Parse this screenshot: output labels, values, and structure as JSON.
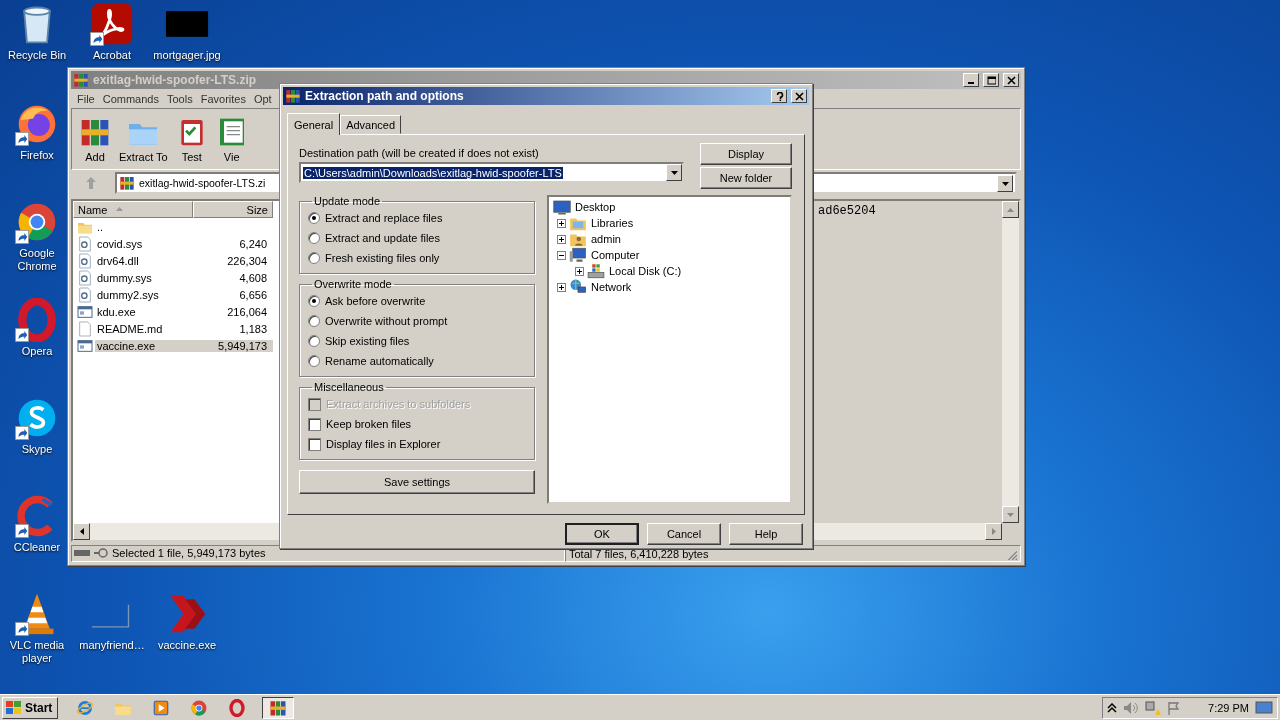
{
  "desktop_icons": [
    {
      "label": "Recycle Bin",
      "kind": "recycle",
      "shortcut": false
    },
    {
      "label": "Acrobat",
      "kind": "acrobat",
      "shortcut": true
    },
    {
      "label": "mortgager.jpg",
      "kind": "image",
      "shortcut": false
    },
    {
      "label": "Firefox",
      "kind": "firefox",
      "shortcut": true
    },
    {
      "label": "Google Chrome",
      "kind": "chrome",
      "shortcut": true
    },
    {
      "label": "Opera",
      "kind": "opera",
      "shortcut": true
    },
    {
      "label": "Skype",
      "kind": "skype",
      "shortcut": true
    },
    {
      "label": "CCleaner",
      "kind": "ccleaner",
      "shortcut": true
    },
    {
      "label": "VLC media player",
      "kind": "vlc",
      "shortcut": true
    },
    {
      "label": "manyfriend…",
      "kind": "blank",
      "shortcut": false
    },
    {
      "label": "vaccine.exe",
      "kind": "vaccine",
      "shortcut": false
    }
  ],
  "archive_window": {
    "title": "exitlag-hwid-spoofer-LTS.zip",
    "menu": [
      "File",
      "Commands",
      "Tools",
      "Favorites",
      "Opt"
    ],
    "toolbar": [
      {
        "label": "Add",
        "kind": "add"
      },
      {
        "label": "Extract To",
        "kind": "extract"
      },
      {
        "label": "Test",
        "kind": "test"
      },
      {
        "label": "Vie",
        "kind": "view"
      }
    ],
    "address": "exitlag-hwid-spoofer-LTS.zi",
    "columns": [
      "Name",
      "Size"
    ],
    "files": [
      {
        "name": "..",
        "kind": "folder",
        "selected": false
      },
      {
        "name": "covid.sys",
        "size": "6,240",
        "kind": "sys",
        "selected": false
      },
      {
        "name": "drv64.dll",
        "size": "226,304",
        "kind": "sys",
        "selected": false
      },
      {
        "name": "dummy.sys",
        "size": "4,608",
        "kind": "sys",
        "selected": false
      },
      {
        "name": "dummy2.sys",
        "size": "6,656",
        "kind": "sys",
        "selected": false
      },
      {
        "name": "kdu.exe",
        "size": "216,064",
        "kind": "exe",
        "selected": false
      },
      {
        "name": "README.md",
        "size": "1,183",
        "kind": "text",
        "selected": false
      },
      {
        "name": "vaccine.exe",
        "size": "5,949,173",
        "kind": "exe",
        "selected": true
      }
    ],
    "comment": "ad6e5204",
    "status": [
      "Selected 1 file, 5,949,173 bytes",
      "Total 7 files, 6,410,228 bytes"
    ]
  },
  "dialog": {
    "title": "Extraction path and options",
    "tabs": [
      {
        "label": "General",
        "selected": true
      },
      {
        "label": "Advanced",
        "selected": false
      }
    ],
    "destination_label": "Destination path (will be created if does not exist)",
    "destination_path": "C:\\Users\\admin\\Downloads\\exitlag-hwid-spoofer-LTS",
    "side_buttons": [
      "Display",
      "New folder"
    ],
    "groups": [
      {
        "title": "Update mode",
        "kind": "radio",
        "options": [
          {
            "label": "Extract and replace files",
            "selected": true
          },
          {
            "label": "Extract and update files",
            "selected": false
          },
          {
            "label": "Fresh existing files only",
            "selected": false
          }
        ]
      },
      {
        "title": "Overwrite mode",
        "kind": "radio",
        "options": [
          {
            "label": "Ask before overwrite",
            "selected": true
          },
          {
            "label": "Overwrite without prompt",
            "selected": false
          },
          {
            "label": "Skip existing files",
            "selected": false
          },
          {
            "label": "Rename automatically",
            "selected": false
          }
        ]
      },
      {
        "title": "Miscellaneous",
        "kind": "checkbox",
        "options": [
          {
            "label": "Extract archives to subfolders",
            "checked": false,
            "disabled": true
          },
          {
            "label": "Keep broken files",
            "checked": false,
            "disabled": false
          },
          {
            "label": "Display files in Explorer",
            "checked": false,
            "disabled": false
          }
        ]
      }
    ],
    "save_button": "Save settings",
    "tree": [
      {
        "label": "Desktop",
        "kind": "desktop",
        "children": [
          {
            "label": "Libraries",
            "kind": "libraries",
            "expanded": false
          },
          {
            "label": "admin",
            "kind": "user",
            "expanded": false
          },
          {
            "label": "Computer",
            "kind": "computer",
            "expanded": true,
            "children": [
              {
                "label": "Local Disk (C:)",
                "kind": "disk",
                "expanded": false
              }
            ]
          },
          {
            "label": "Network",
            "kind": "network",
            "expanded": false
          }
        ]
      }
    ],
    "buttons": [
      {
        "label": "OK",
        "default": true
      },
      {
        "label": "Cancel",
        "default": false
      },
      {
        "label": "Help",
        "default": false
      }
    ]
  },
  "taskbar": {
    "start": "Start",
    "apps": [
      {
        "kind": "ie",
        "active": false
      },
      {
        "kind": "explorer",
        "active": false
      },
      {
        "kind": "media",
        "active": false
      },
      {
        "kind": "chrome",
        "active": false
      },
      {
        "kind": "opera",
        "active": false
      },
      {
        "kind": "winrar",
        "active": true
      }
    ],
    "clock": "7:29 PM"
  }
}
